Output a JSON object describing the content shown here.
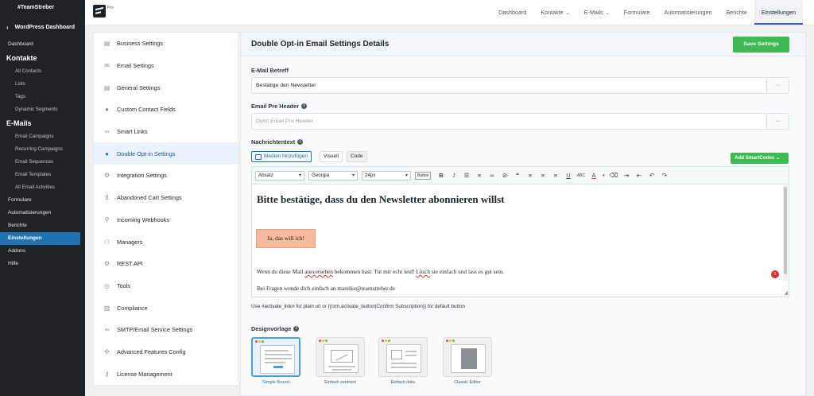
{
  "wp_sidebar": {
    "site": "#TeamStreber",
    "back_label": "WordPress Dashboard",
    "items": [
      {
        "label": "Dashboard",
        "kind": "item"
      },
      {
        "label": "Kontakte",
        "kind": "head"
      },
      {
        "label": "All Contacts",
        "kind": "sub"
      },
      {
        "label": "Lists",
        "kind": "sub"
      },
      {
        "label": "Tags",
        "kind": "sub"
      },
      {
        "label": "Dynamic Segments",
        "kind": "sub"
      },
      {
        "label": "E-Mails",
        "kind": "head"
      },
      {
        "label": "Email Campaigns",
        "kind": "sub"
      },
      {
        "label": "Recurring Campaigns",
        "kind": "sub"
      },
      {
        "label": "Email Sequences",
        "kind": "sub"
      },
      {
        "label": "Email Templates",
        "kind": "sub"
      },
      {
        "label": "All Email Activities",
        "kind": "sub"
      },
      {
        "label": "Formulare",
        "kind": "item"
      },
      {
        "label": "Automatisierungen",
        "kind": "item"
      },
      {
        "label": "Berichte",
        "kind": "item"
      },
      {
        "label": "Einstellungen",
        "kind": "item",
        "active": true
      },
      {
        "label": "Addons",
        "kind": "item"
      },
      {
        "label": "Hilfe",
        "kind": "item"
      }
    ]
  },
  "header": {
    "brand_badge": "Pro",
    "nav": [
      {
        "label": "Dashboard",
        "dropdown": false
      },
      {
        "label": "Kontakte",
        "dropdown": true
      },
      {
        "label": "E-Mails",
        "dropdown": true
      },
      {
        "label": "Formulare",
        "dropdown": false
      },
      {
        "label": "Automatisierungen",
        "dropdown": false
      },
      {
        "label": "Berichte",
        "dropdown": false
      },
      {
        "label": "Einstellungen",
        "dropdown": false,
        "active": true
      }
    ]
  },
  "settings_nav": [
    {
      "label": "Business Settings",
      "icon": "document-icon"
    },
    {
      "label": "Email Settings",
      "icon": "envelope-icon"
    },
    {
      "label": "General Settings",
      "icon": "document-icon"
    },
    {
      "label": "Custom Contact Fields",
      "icon": "person-icon"
    },
    {
      "label": "Smart Links",
      "icon": "link-icon"
    },
    {
      "label": "Double Opt-in Settings",
      "icon": "person-icon",
      "active": true
    },
    {
      "label": "Integration Settings",
      "icon": "gear-icon"
    },
    {
      "label": "Abandoned Cart Settings",
      "icon": "cart-icon"
    },
    {
      "label": "Incoming Webhooks",
      "icon": "webhook-icon"
    },
    {
      "label": "Managers",
      "icon": "people-icon"
    },
    {
      "label": "REST API",
      "icon": "gear-icon"
    },
    {
      "label": "Tools",
      "icon": "globe-icon"
    },
    {
      "label": "Compliance",
      "icon": "clipboard-icon"
    },
    {
      "label": "SMTP/Email Service Settings",
      "icon": "link-icon"
    },
    {
      "label": "Advanced Features Config",
      "icon": "puzzle-icon"
    },
    {
      "label": "License Management",
      "icon": "key-icon"
    }
  ],
  "main": {
    "title": "Double Opt-in Email Settings Details",
    "save_label": "Save Settings",
    "subject_label": "E-Mail Betreff",
    "subject_value": "Bestätige den Newsletter",
    "preheader_label": "Email Pre Header",
    "preheader_placeholder": "Optin Email Pre Header",
    "more_label": "···",
    "body_label": "Nachrichtentext",
    "media_label": "Medien hinzufügen",
    "tab_visual": "Visuell",
    "tab_code": "Code",
    "smartcodes_label": "Add SmartCodes",
    "toolbar": {
      "format": "Absatz",
      "font": "Georgia",
      "size": "24px",
      "button_label": "Button"
    },
    "content": {
      "heading": "Bitte bestätige, dass du den Newsletter abonnieren willst",
      "button": "Ja, das will ich!",
      "p1_a": "Wenn du diese Mail ",
      "p1_b": "ausversehen",
      "p1_c": " bekommen hast: Tut mir echt leid! ",
      "p1_d": "Lösch",
      "p1_e": " sie einfach und lass es gut sein.",
      "p2": "Bei Fragen wende dich einfach an mareike@teamstreber.de"
    },
    "notification_count": "1",
    "help_text": "Use #activate_link# for plain url or {{crm.activate_button|Confirm Subscription}} for default button",
    "design_label": "Designvorlage",
    "templates": [
      {
        "label": "Simple Boxed",
        "selected": true
      },
      {
        "label": "Einfach zentriert",
        "selected": false
      },
      {
        "label": "Einfach links",
        "selected": false
      },
      {
        "label": "Classic Editor",
        "selected": false
      }
    ]
  }
}
